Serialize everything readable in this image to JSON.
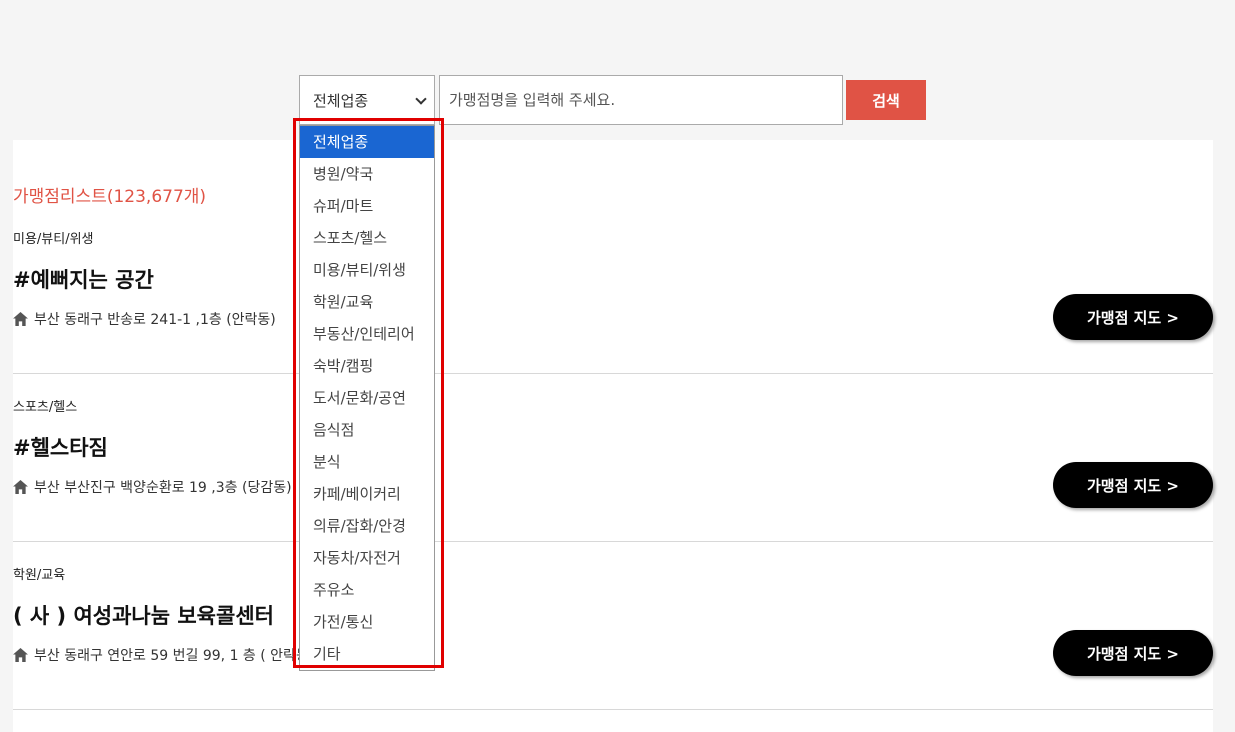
{
  "search": {
    "selected_category": "전체업종",
    "placeholder": "가맹점명을 입력해 주세요.",
    "search_label": "검색"
  },
  "list": {
    "title": "가맹점리스트(123,677개)",
    "map_button_label": "가맹점 지도 >",
    "stores": [
      {
        "category": "미용/뷰티/위생",
        "name": "#예뻐지는 공간",
        "address": "부산 동래구 반송로 241-1 ,1층 (안락동)"
      },
      {
        "category": "스포츠/헬스",
        "name": "#헬스타짐",
        "address": "부산 부산진구 백양순환로 19 ,3층 (당감동)"
      },
      {
        "category": "학원/교육",
        "name": "( 사 ) 여성과나눔 보육콜센터",
        "address": "부산 동래구 연안로 59 번길 99, 1 층 ( 안락동 )"
      }
    ]
  },
  "dropdown": {
    "options": [
      "전체업종",
      "병원/약국",
      "슈퍼/마트",
      "스포츠/헬스",
      "미용/뷰티/위생",
      "학원/교육",
      "부동산/인테리어",
      "숙박/캠핑",
      "도서/문화/공연",
      "음식점",
      "분식",
      "카페/베이커리",
      "의류/잡화/안경",
      "자동차/자전거",
      "주유소",
      "가전/통신",
      "기타"
    ],
    "selected_index": 0
  },
  "colors": {
    "accent": "#e05345",
    "selected_option": "#1a66d2",
    "highlight": "#e00000"
  }
}
